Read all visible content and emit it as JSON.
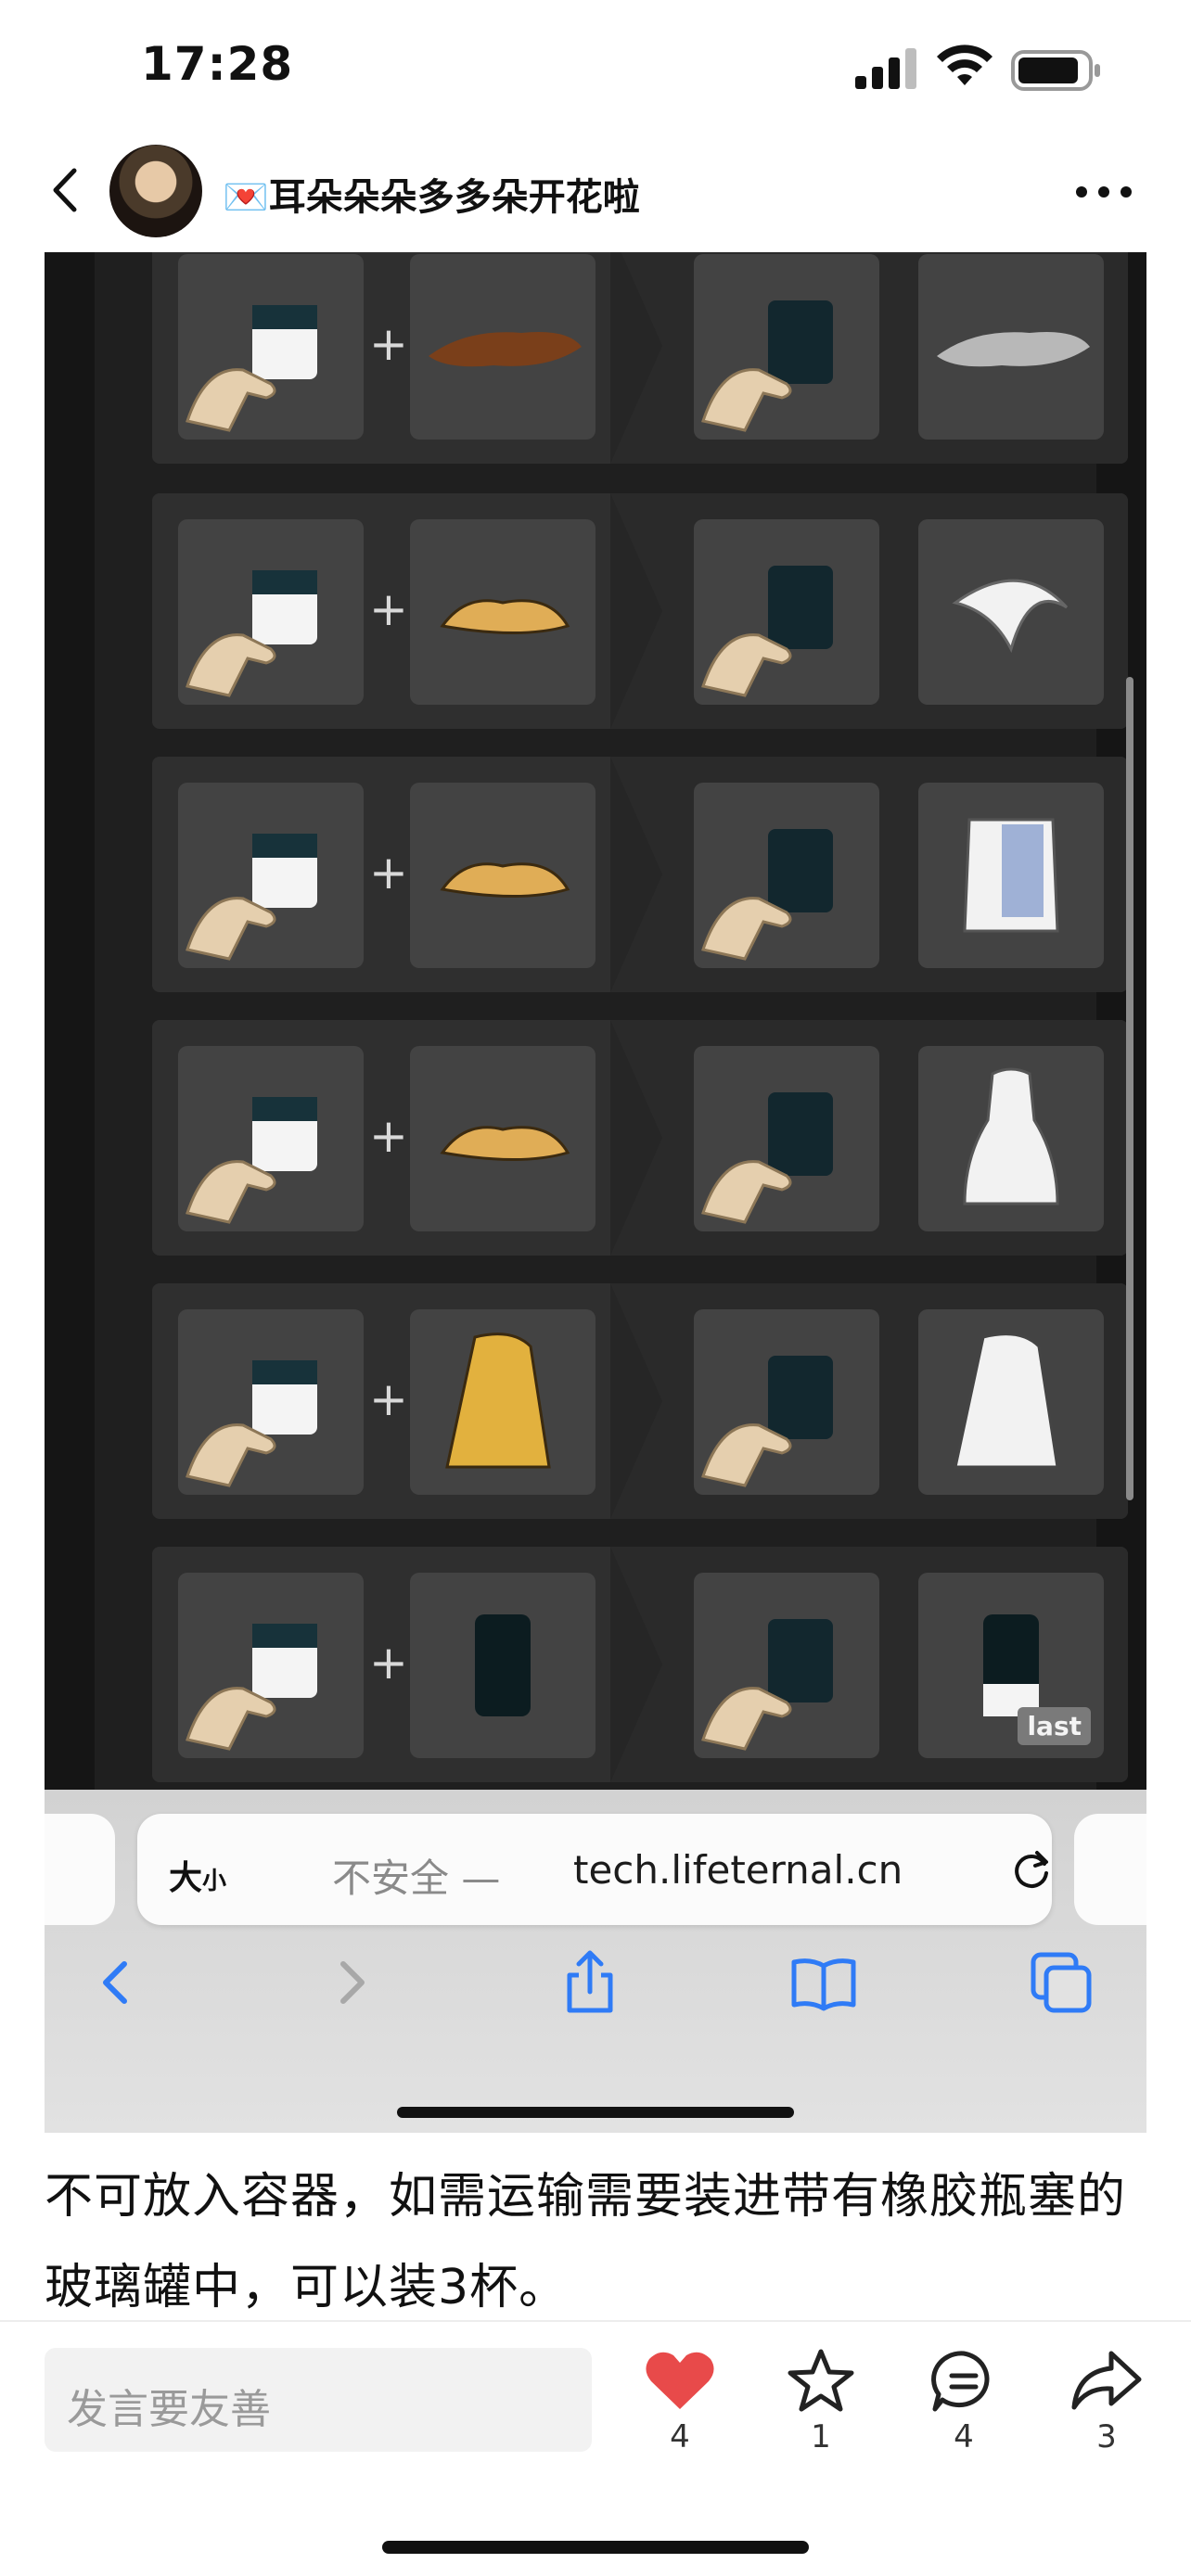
{
  "status_bar": {
    "time": "17:28"
  },
  "header": {
    "author": "💌耳朵朵朵多多朵开花啦"
  },
  "panel": {
    "badge": "last",
    "plus": "+"
  },
  "browser": {
    "text_size": "大",
    "text_size_small": "小",
    "not_secure": "不安全 —",
    "domain": "tech.lifeternal.cn"
  },
  "post": {
    "text": "不可放入容器，如需运输需要装进带有橡胶瓶塞的玻璃罐中，可以装3杯。"
  },
  "bottom_bar": {
    "comment_placeholder": "发言要友善",
    "like_count": "4",
    "star_count": "1",
    "comment_count": "4",
    "share_count": "3"
  },
  "colors": {
    "like": "#e84a4a",
    "ios_blue": "#2f7bf6"
  }
}
